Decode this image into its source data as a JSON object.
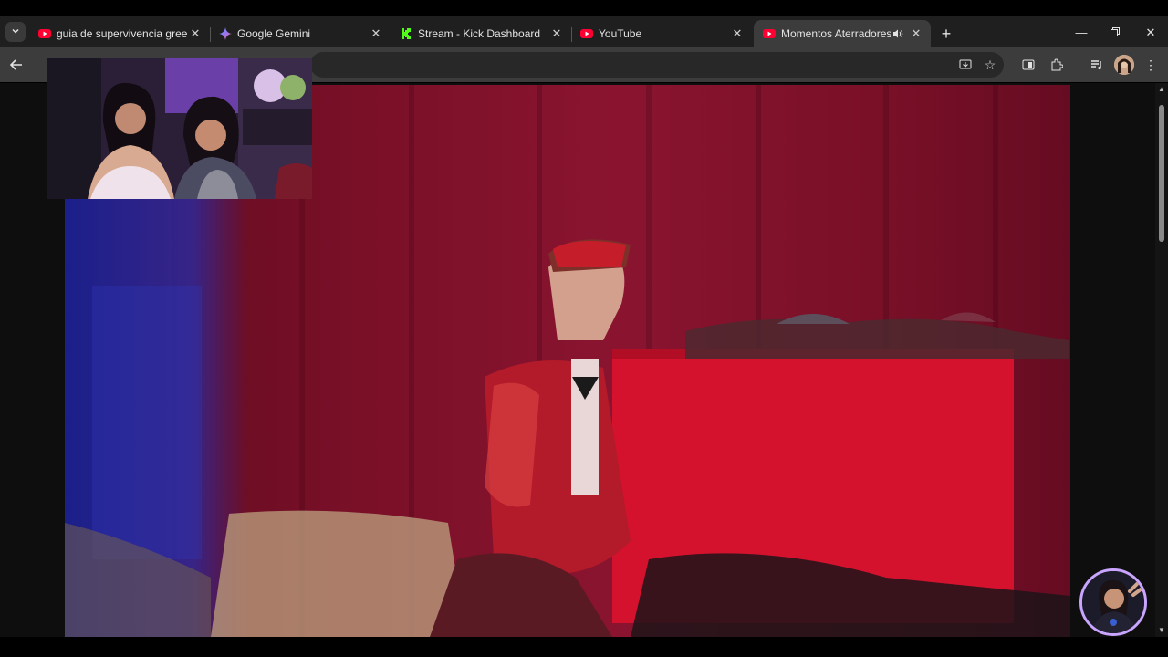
{
  "browser": {
    "tabs": [
      {
        "title": "guia de supervivencia green he",
        "favicon": "youtube-icon",
        "active": false
      },
      {
        "title": "Google Gemini",
        "favicon": "gemini-icon",
        "active": false
      },
      {
        "title": "Stream - Kick Dashboard",
        "favicon": "kick-icon",
        "active": false
      },
      {
        "title": "YouTube",
        "favicon": "youtube-icon",
        "active": false
      },
      {
        "title": "Momentos Aterradores Tran",
        "favicon": "youtube-icon",
        "active": true,
        "audio": "speaker-icon"
      }
    ],
    "colors": {
      "youtube_red": "#ff0033",
      "kick_green": "#53fc18",
      "tab_active_bg": "#3c3c3c",
      "toolbar_bg": "#3c3c3c",
      "avatar_ring": "#c9a5ff"
    }
  }
}
